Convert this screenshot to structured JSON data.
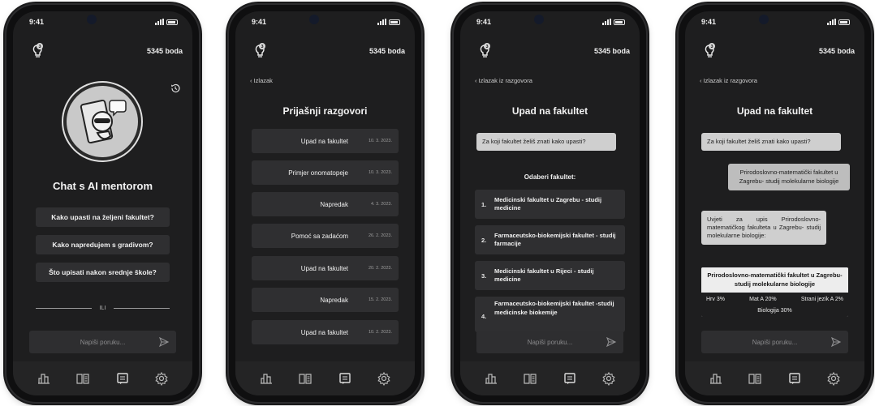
{
  "status": {
    "time": "9:41"
  },
  "points": "5345 boda",
  "screen1": {
    "title": "Chat s AI mentorom",
    "suggestions": [
      "Kako upasti na željeni fakultet?",
      "Kako napredujem s gradivom?",
      "Što upisati nakon srednje škole?"
    ],
    "or_label": "ILI",
    "input_placeholder": "Napiši poruku..."
  },
  "screen2": {
    "back": "Izlazak",
    "title": "Prijašnji razgovori",
    "items": [
      {
        "title": "Upad na fakultet",
        "date": "10. 3. 2023."
      },
      {
        "title": "Primjer onomatopeje",
        "date": "10. 3. 2023."
      },
      {
        "title": "Napredak",
        "date": "4. 3. 2023."
      },
      {
        "title": "Pomoć sa zadaćom",
        "date": "26. 2. 2023."
      },
      {
        "title": "Upad na fakultet",
        "date": "20. 2. 2023."
      },
      {
        "title": "Napredak",
        "date": "15. 2. 2023."
      },
      {
        "title": "Upad na fakultet",
        "date": "10. 2. 2023."
      }
    ]
  },
  "screen3": {
    "back": "Izlazak iz razgovora",
    "title": "Upad na fakultet",
    "bot_question": "Za koji fakultet želiš znati kako upasti?",
    "choose_label": "Odaberi fakultet:",
    "options": [
      {
        "num": "1.",
        "text": "Medicinski fakultet u Zagrebu - studij medicine"
      },
      {
        "num": "2.",
        "text": "Farmaceutsko-biokemijski fakultet - studij farmacije"
      },
      {
        "num": "3.",
        "text": "Medicinski fakultet u Rijeci - studij medicine"
      },
      {
        "num": "4.",
        "text": "Farmaceutsko-biokemijski fakultet -studij medicinske biokemije"
      }
    ],
    "input_placeholder": "Napiši poruku..."
  },
  "screen4": {
    "back": "Izlazak iz razgovora",
    "title": "Upad na fakultet",
    "bot_question": "Za koji fakultet želiš znati kako upasti?",
    "user_answer": "Prirodoslovno-matematički fakultet u Zagrebu- studij molekularne biologije",
    "bot_reply": "Uvjeti za upis Prirodoslovno-matematičkog fakulteta u Zagrebu- studij molekularne biologije:",
    "card": {
      "title": "Prirodoslovno-matematički fakultet u Zagrebu- studij molekularne biologije",
      "row": [
        "Hrv 3%",
        "Mat A 20%",
        "Strani jezik A 2%"
      ],
      "row2": "Biologija 30%"
    },
    "input_placeholder": "Napiši poruku..."
  },
  "icons": {
    "bulb": "lightbulb-icon",
    "history": "history-icon",
    "nav": [
      "stats-icon",
      "book-icon",
      "chat-icon",
      "gear-icon"
    ],
    "send": "send-icon",
    "back": "chevron-left-icon"
  }
}
